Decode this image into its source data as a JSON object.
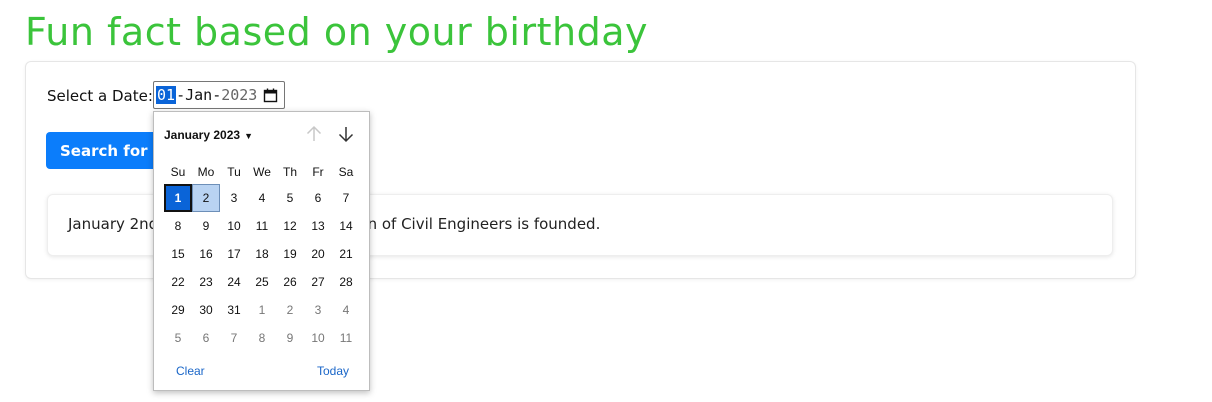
{
  "title": "Fun fact based on your birthday",
  "form": {
    "label": "Select a Date:",
    "date_day": "01",
    "date_sep1": "-",
    "date_month": "Jan",
    "date_sep2": "-",
    "date_year": "2023",
    "search_label": "Search for a fact"
  },
  "result": {
    "text": "January 2nd, 1818: The British Institution of Civil Engineers is founded."
  },
  "calendar": {
    "month_label": "January 2023",
    "weekdays": [
      "Su",
      "Mo",
      "Tu",
      "We",
      "Th",
      "Fr",
      "Sa"
    ],
    "weeks": [
      [
        "1",
        "2",
        "3",
        "4",
        "5",
        "6",
        "7"
      ],
      [
        "8",
        "9",
        "10",
        "11",
        "12",
        "13",
        "14"
      ],
      [
        "15",
        "16",
        "17",
        "18",
        "19",
        "20",
        "21"
      ],
      [
        "22",
        "23",
        "24",
        "25",
        "26",
        "27",
        "28"
      ],
      [
        "29",
        "30",
        "31",
        "1",
        "2",
        "3",
        "4"
      ],
      [
        "5",
        "6",
        "7",
        "8",
        "9",
        "10",
        "11"
      ]
    ],
    "selected_day": "1",
    "hovered_day": "2",
    "clear_label": "Clear",
    "today_label": "Today"
  },
  "colors": {
    "title": "#3bc43b",
    "button": "#0b7dfb",
    "selected": "#0a64d8",
    "link": "#1a66c8"
  }
}
